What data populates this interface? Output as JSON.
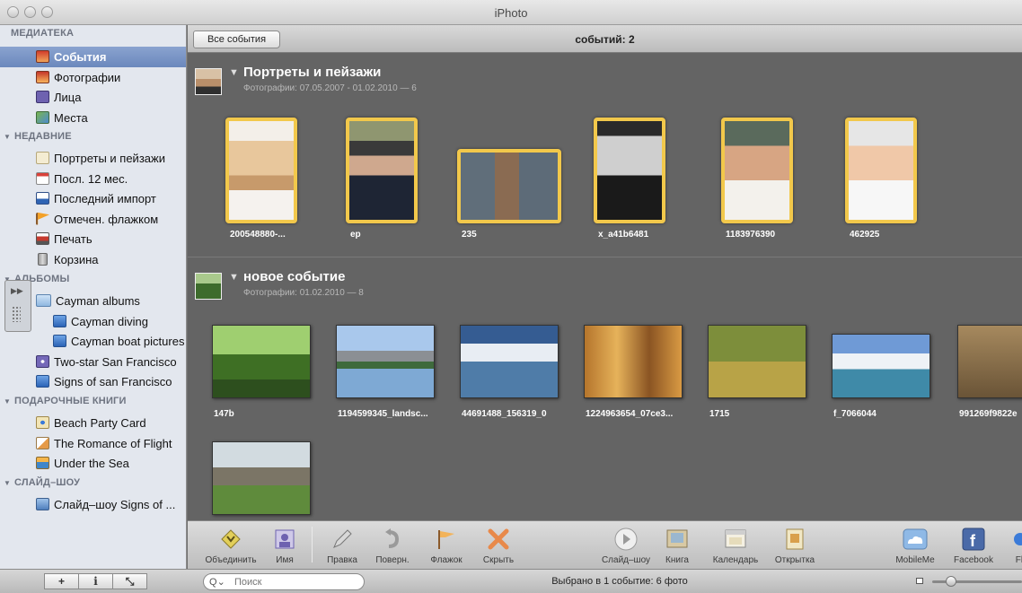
{
  "window": {
    "title": "iPhoto"
  },
  "sidebar": {
    "sections": [
      {
        "label": "МЕДИАТЕКА",
        "items": [
          {
            "label": "События",
            "icon": "events-icon",
            "selected": true
          },
          {
            "label": "Фотографии",
            "icon": "photos-icon"
          },
          {
            "label": "Лица",
            "icon": "faces-icon"
          },
          {
            "label": "Места",
            "icon": "places-icon"
          }
        ]
      },
      {
        "label": "НЕДАВНИЕ",
        "items": [
          {
            "label": "Портреты и пейзажи",
            "icon": "event-icon"
          },
          {
            "label": "Посл. 12 мес.",
            "icon": "calendar-icon"
          },
          {
            "label": "Последний импорт",
            "icon": "import-icon"
          },
          {
            "label": "Отмечен. флажком",
            "icon": "flag-icon"
          },
          {
            "label": "Печать",
            "icon": "print-icon"
          },
          {
            "label": "Корзина",
            "icon": "trash-icon"
          }
        ]
      },
      {
        "label": "АЛЬБОМЫ",
        "items": [
          {
            "label": "Cayman albums",
            "icon": "folder-icon"
          },
          {
            "label": "Cayman diving",
            "icon": "album-icon"
          },
          {
            "label": "Cayman boat pictures",
            "icon": "album-icon"
          },
          {
            "label": "Two-star San Francisco",
            "icon": "smart-album-icon"
          },
          {
            "label": "Signs of san Francisco",
            "icon": "album-icon"
          }
        ]
      },
      {
        "label": "ПОДАРОЧНЫЕ КНИГИ",
        "items": [
          {
            "label": "Beach Party Card",
            "icon": "card-icon"
          },
          {
            "label": "The Romance of Flight",
            "icon": "book-icon"
          },
          {
            "label": "Under the Sea",
            "icon": "book-icon"
          }
        ]
      },
      {
        "label": "СЛАЙД–ШОУ",
        "items": [
          {
            "label": "Слайд–шоу Signs of ...",
            "icon": "slideshow-icon"
          }
        ]
      }
    ]
  },
  "header": {
    "back_label": "Все события",
    "count_label": "событий: 2"
  },
  "events": [
    {
      "title": "Портреты и пейзажи",
      "subtitle": "Фотографии: 07.05.2007 - 01.02.2010 — 6",
      "photos": [
        {
          "caption": "200548880-..."
        },
        {
          "caption": "ep"
        },
        {
          "caption": "235"
        },
        {
          "caption": "x_a41b6481"
        },
        {
          "caption": "1183976390"
        },
        {
          "caption": "462925"
        }
      ]
    },
    {
      "title": "новое событие",
      "subtitle": "Фотографии: 01.02.2010 — 8",
      "photos": [
        {
          "caption": "147b"
        },
        {
          "caption": "1194599345_landsc..."
        },
        {
          "caption": "44691488_156319_0"
        },
        {
          "caption": "1224963654_07ce3..."
        },
        {
          "caption": "1715"
        },
        {
          "caption": "f_7066044"
        },
        {
          "caption": "991269f9822e"
        },
        {
          "caption": ""
        }
      ]
    }
  ],
  "toolbar": {
    "merge": "Объединить",
    "name": "Имя",
    "edit": "Правка",
    "rotate": "Поверн.",
    "flag": "Флажок",
    "hide": "Скрыть",
    "slideshow": "Слайд–шоу",
    "book": "Книга",
    "calendar": "Календарь",
    "card": "Открытка",
    "mobileme": "MobileMe",
    "facebook": "Facebook",
    "flickr": "Fli"
  },
  "bottom": {
    "add": "+",
    "info": "i",
    "fullscreen": "⤡",
    "search_placeholder": "Поиск",
    "search_prefix": "Q",
    "status": "Выбрано в 1 событие: 6 фото"
  },
  "colors": {
    "selection": "#f2c84b",
    "sidebar_bg": "#e3e7ee",
    "content_bg": "#646464"
  }
}
